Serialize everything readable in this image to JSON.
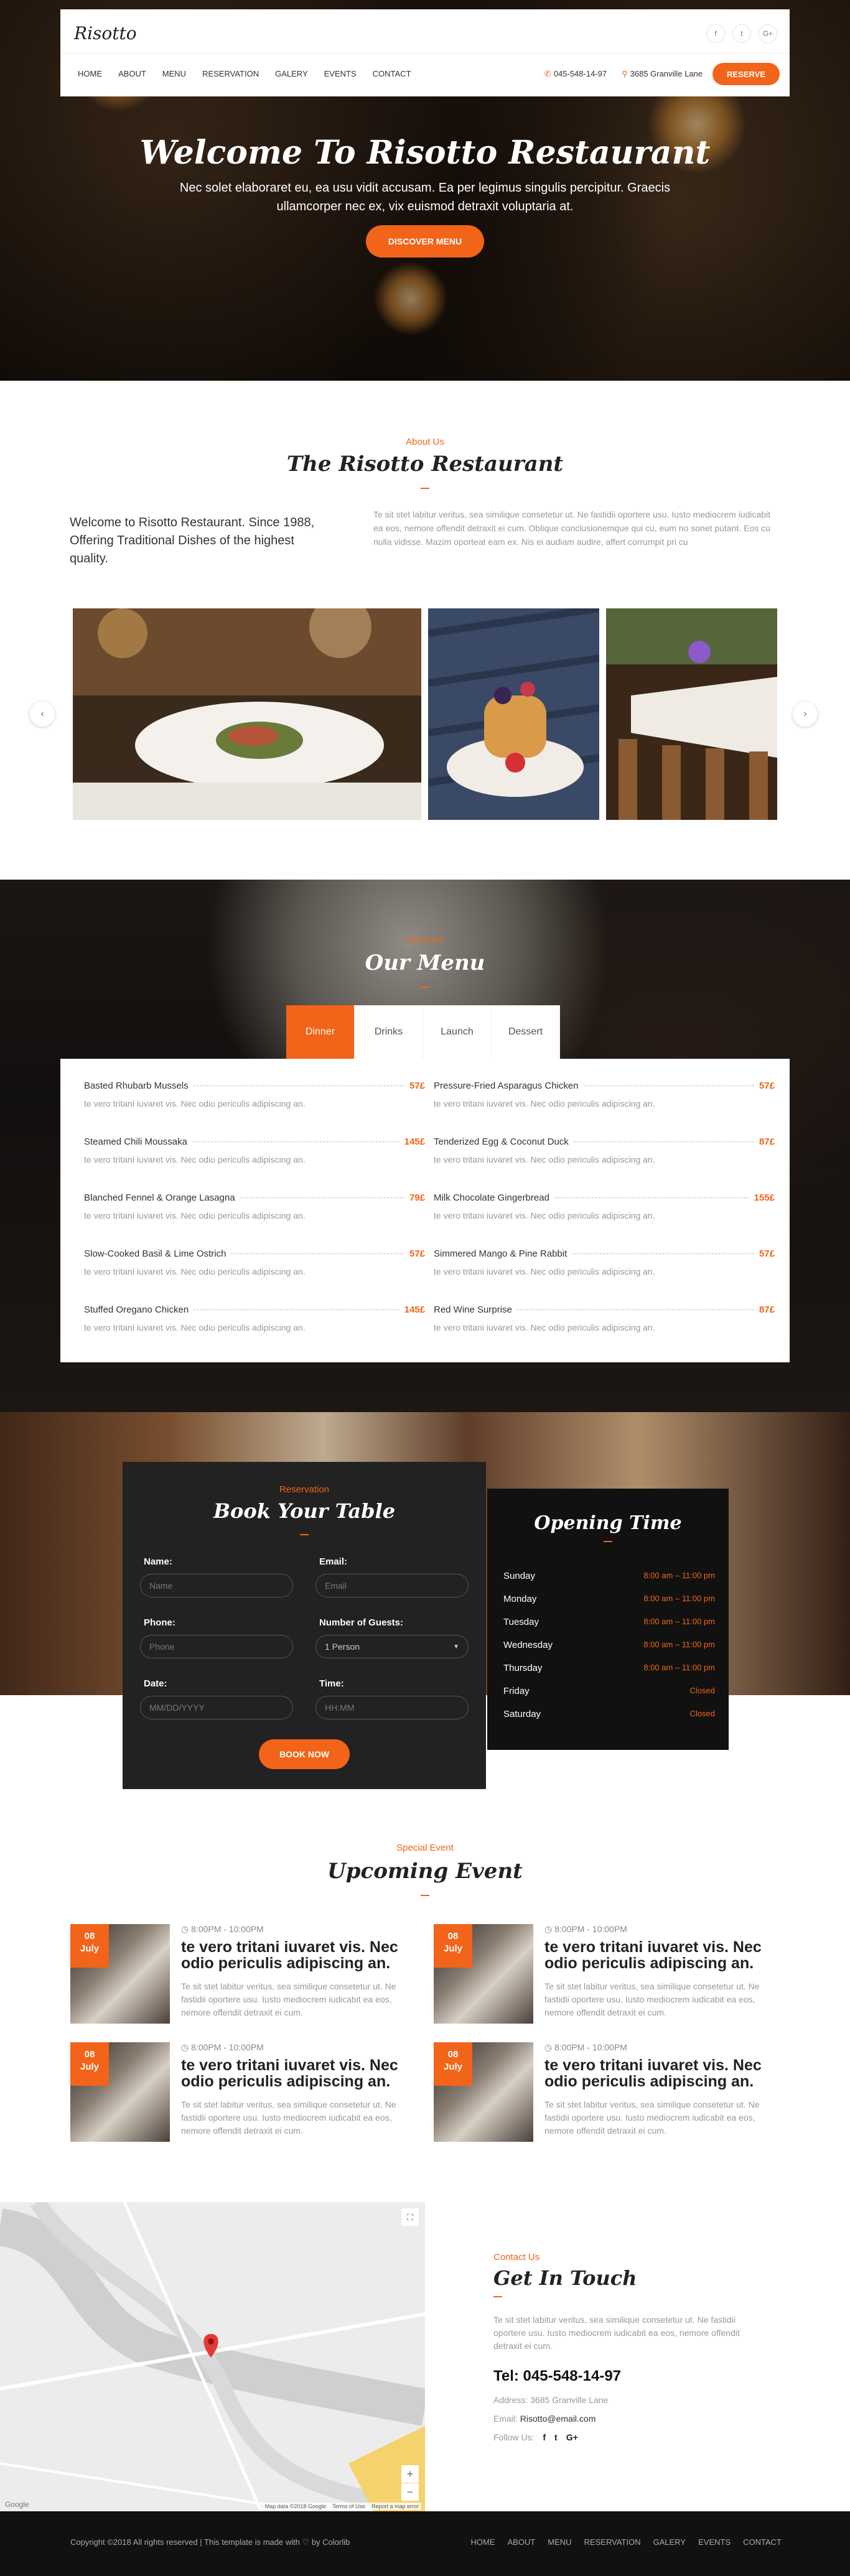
{
  "header": {
    "logo": "Risotto",
    "social": [
      "f",
      "t",
      "G+"
    ],
    "nav": [
      "HOME",
      "ABOUT",
      "MENU",
      "RESERVATION",
      "GALERY",
      "EVENTS",
      "CONTACT"
    ],
    "phone": "045-548-14-97",
    "address": "3685 Granville Lane",
    "reserve": "RESERVE"
  },
  "hero": {
    "title": "Welcome To Risotto Restaurant",
    "text": "Nec solet elaboraret eu, ea usu vidit accusam. Ea per legimus singulis percipitur. Graecis ullamcorper nec ex, vix euismod detraxit voluptaria at.",
    "button": "DISCOVER MENU"
  },
  "about": {
    "sub": "About Us",
    "title": "The Risotto Restaurant",
    "left": "Welcome to Risotto Restaurant. Since 1988, Offering Traditional Dishes of the highest quality.",
    "right": "Te sit stet labitur veritus, sea similique consetetur ut. Ne fastidii oportere usu. Iusto mediocrem iudicabit ea eos, nemore offendit detraxit ei cum. Oblique conclusionemque qui cu, eum no sonet putant. Eos cu nulla vidisse. Mazim oporteat eam ex. Nis ei audiam audire, affert corrumpit pri cu"
  },
  "menu": {
    "sub": "Discover",
    "title": "Our Menu",
    "tabs": [
      "Dinner",
      "Drinks",
      "Launch",
      "Dessert"
    ],
    "items": [
      {
        "name": "Basted Rhubarb Mussels",
        "price": "57£",
        "desc": "te vero tritani iuvaret vis. Nec odio periculis adipiscing an."
      },
      {
        "name": "Pressure-Fried Asparagus Chicken",
        "price": "57£",
        "desc": "te vero tritani iuvaret vis. Nec odio periculis adipiscing an."
      },
      {
        "name": "Steamed Chili Moussaka",
        "price": "145£",
        "desc": "te vero tritani iuvaret vis. Nec odio periculis adipiscing an."
      },
      {
        "name": "Tenderized Egg & Coconut Duck",
        "price": "87£",
        "desc": "te vero tritani iuvaret vis. Nec odio periculis adipiscing an."
      },
      {
        "name": "Blanched Fennel & Orange Lasagna",
        "price": "79£",
        "desc": "te vero tritani iuvaret vis. Nec odio periculis adipiscing an."
      },
      {
        "name": "Milk Chocolate Gingerbread",
        "price": "155£",
        "desc": "te vero tritani iuvaret vis. Nec odio periculis adipiscing an."
      },
      {
        "name": "Slow-Cooked Basil & Lime Ostrich",
        "price": "57£",
        "desc": "te vero tritani iuvaret vis. Nec odio periculis adipiscing an."
      },
      {
        "name": "Simmered Mango & Pine Rabbit",
        "price": "57£",
        "desc": "te vero tritani iuvaret vis. Nec odio periculis adipiscing an."
      },
      {
        "name": "Stuffed Oregano Chicken",
        "price": "145£",
        "desc": "te vero tritani iuvaret vis. Nec odio periculis adipiscing an."
      },
      {
        "name": "Red Wine Surprise",
        "price": "87£",
        "desc": "te vero tritani iuvaret vis. Nec odio periculis adipiscing an."
      }
    ]
  },
  "reservation": {
    "sub": "Reservation",
    "title": "Book Your Table",
    "name_label": "Name:",
    "name_ph": "Name",
    "email_label": "Email:",
    "email_ph": "Email",
    "phone_label": "Phone:",
    "phone_ph": "Phone",
    "guests_label": "Number of Guests:",
    "guests_value": "1 Person",
    "date_label": "Date:",
    "date_ph": "MM/DD/YYYY",
    "time_label": "Time:",
    "time_ph": "HH:MM",
    "button": "BOOK NOW"
  },
  "opening": {
    "title": "Opening Time",
    "rows": [
      {
        "day": "Sunday",
        "hours": "8:00 am – 11:00 pm"
      },
      {
        "day": "Monday",
        "hours": "8:00 am – 11:00 pm"
      },
      {
        "day": "Tuesday",
        "hours": "8:00 am – 11:00 pm"
      },
      {
        "day": "Wednesday",
        "hours": "8:00 am – 11:00 pm"
      },
      {
        "day": "Thursday",
        "hours": "8:00 am – 11:00 pm"
      },
      {
        "day": "Friday",
        "hours": "Closed"
      },
      {
        "day": "Saturday",
        "hours": "Closed"
      }
    ]
  },
  "events": {
    "sub": "Special Event",
    "title": "Upcoming Event",
    "items": [
      {
        "day": "08",
        "month": "July",
        "time": "8:00PM - 10:00PM",
        "title": "te vero tritani iuvaret vis. Nec odio periculis adipiscing an.",
        "desc": "Te sit stet labitur veritus, sea similique consetetur ut. Ne fastidii oportere usu. Iusto mediocrem iudicabit ea eos, nemore offendit detraxit ei cum."
      },
      {
        "day": "08",
        "month": "July",
        "time": "8:00PM - 10:00PM",
        "title": "te vero tritani iuvaret vis. Nec odio periculis adipiscing an.",
        "desc": "Te sit stet labitur veritus, sea similique consetetur ut. Ne fastidii oportere usu. Iusto mediocrem iudicabit ea eos, nemore offendit detraxit ei cum."
      },
      {
        "day": "08",
        "month": "July",
        "time": "8:00PM - 10:00PM",
        "title": "te vero tritani iuvaret vis. Nec odio periculis adipiscing an.",
        "desc": "Te sit stet labitur veritus, sea similique consetetur ut. Ne fastidii oportere usu. Iusto mediocrem iudicabit ea eos, nemore offendit detraxit ei cum."
      },
      {
        "day": "08",
        "month": "July",
        "time": "8:00PM - 10:00PM",
        "title": "te vero tritani iuvaret vis. Nec odio periculis adipiscing an.",
        "desc": "Te sit stet labitur veritus, sea similique consetetur ut. Ne fastidii oportere usu. Iusto mediocrem iudicabit ea eos, nemore offendit detraxit ei cum."
      }
    ]
  },
  "contact": {
    "sub": "Contact Us",
    "title": "Get In Touch",
    "text": "Te sit stet labitur veritus, sea similique consetetur ut. Ne fastidii oportere usu. Iusto mediocrem iudicabit ea eos, nemore offendit detraxit ei cum.",
    "tel": "Tel: 045-548-14-97",
    "address": "Address: 3685 Granville Lane",
    "email_label": "Email:",
    "email": "Risotto@email.com",
    "follow": "Follow Us:"
  },
  "map": {
    "zoom_in": "+",
    "zoom_out": "−",
    "fullscreen": "⛶",
    "attribution": "Map data ©2018 Google",
    "terms": "Terms of Use",
    "report": "Report a map error",
    "brand": "Google"
  },
  "footer": {
    "copyright": "Copyright ©2018 All rights reserved | This template is made with ♡ by Colorlib",
    "nav": [
      "HOME",
      "ABOUT",
      "MENU",
      "RESERVATION",
      "GALERY",
      "EVENTS",
      "CONTACT"
    ]
  },
  "colors": {
    "accent": "#f26419",
    "dark": "#222222",
    "footer": "#111111"
  }
}
